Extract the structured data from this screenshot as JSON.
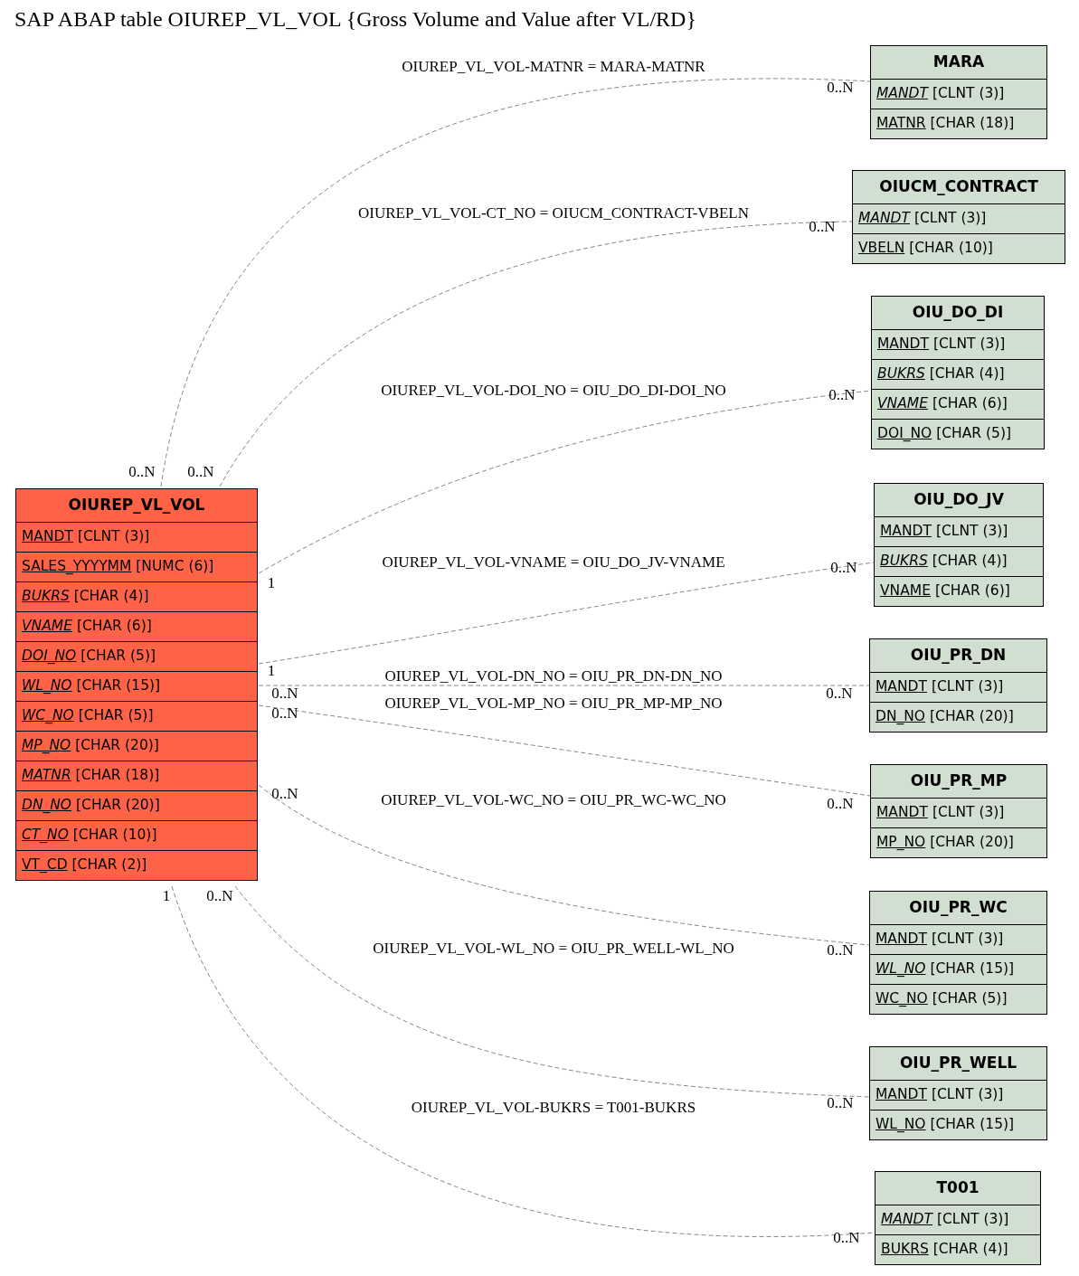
{
  "title": "SAP ABAP table OIUREP_VL_VOL {Gross Volume and Value after VL/RD}",
  "main_table": {
    "name": "OIUREP_VL_VOL",
    "fields": [
      {
        "name": "MANDT",
        "type": "[CLNT (3)]",
        "italic": false
      },
      {
        "name": "SALES_YYYYMM",
        "type": "[NUMC (6)]",
        "italic": false
      },
      {
        "name": "BUKRS",
        "type": "[CHAR (4)]",
        "italic": true
      },
      {
        "name": "VNAME",
        "type": "[CHAR (6)]",
        "italic": true
      },
      {
        "name": "DOI_NO",
        "type": "[CHAR (5)]",
        "italic": true
      },
      {
        "name": "WL_NO",
        "type": "[CHAR (15)]",
        "italic": true
      },
      {
        "name": "WC_NO",
        "type": "[CHAR (5)]",
        "italic": true
      },
      {
        "name": "MP_NO",
        "type": "[CHAR (20)]",
        "italic": true
      },
      {
        "name": "MATNR",
        "type": "[CHAR (18)]",
        "italic": true
      },
      {
        "name": "DN_NO",
        "type": "[CHAR (20)]",
        "italic": true
      },
      {
        "name": "CT_NO",
        "type": "[CHAR (10)]",
        "italic": true
      },
      {
        "name": "VT_CD",
        "type": "[CHAR (2)]",
        "italic": false
      }
    ]
  },
  "related_tables": [
    {
      "name": "MARA",
      "fields": [
        {
          "name": "MANDT",
          "type": "[CLNT (3)]",
          "italic": true
        },
        {
          "name": "MATNR",
          "type": "[CHAR (18)]",
          "italic": false
        }
      ]
    },
    {
      "name": "OIUCM_CONTRACT",
      "fields": [
        {
          "name": "MANDT",
          "type": "[CLNT (3)]",
          "italic": true
        },
        {
          "name": "VBELN",
          "type": "[CHAR (10)]",
          "italic": false
        }
      ]
    },
    {
      "name": "OIU_DO_DI",
      "fields": [
        {
          "name": "MANDT",
          "type": "[CLNT (3)]",
          "italic": false
        },
        {
          "name": "BUKRS",
          "type": "[CHAR (4)]",
          "italic": true
        },
        {
          "name": "VNAME",
          "type": "[CHAR (6)]",
          "italic": true
        },
        {
          "name": "DOI_NO",
          "type": "[CHAR (5)]",
          "italic": false
        }
      ]
    },
    {
      "name": "OIU_DO_JV",
      "fields": [
        {
          "name": "MANDT",
          "type": "[CLNT (3)]",
          "italic": false
        },
        {
          "name": "BUKRS",
          "type": "[CHAR (4)]",
          "italic": true
        },
        {
          "name": "VNAME",
          "type": "[CHAR (6)]",
          "italic": false
        }
      ]
    },
    {
      "name": "OIU_PR_DN",
      "fields": [
        {
          "name": "MANDT",
          "type": "[CLNT (3)]",
          "italic": false
        },
        {
          "name": "DN_NO",
          "type": "[CHAR (20)]",
          "italic": false
        }
      ]
    },
    {
      "name": "OIU_PR_MP",
      "fields": [
        {
          "name": "MANDT",
          "type": "[CLNT (3)]",
          "italic": false
        },
        {
          "name": "MP_NO",
          "type": "[CHAR (20)]",
          "italic": false
        }
      ]
    },
    {
      "name": "OIU_PR_WC",
      "fields": [
        {
          "name": "MANDT",
          "type": "[CLNT (3)]",
          "italic": false
        },
        {
          "name": "WL_NO",
          "type": "[CHAR (15)]",
          "italic": true
        },
        {
          "name": "WC_NO",
          "type": "[CHAR (5)]",
          "italic": false
        }
      ]
    },
    {
      "name": "OIU_PR_WELL",
      "fields": [
        {
          "name": "MANDT",
          "type": "[CLNT (3)]",
          "italic": false
        },
        {
          "name": "WL_NO",
          "type": "[CHAR (15)]",
          "italic": false
        }
      ]
    },
    {
      "name": "T001",
      "fields": [
        {
          "name": "MANDT",
          "type": "[CLNT (3)]",
          "italic": true
        },
        {
          "name": "BUKRS",
          "type": "[CHAR (4)]",
          "italic": false
        }
      ]
    }
  ],
  "relations": [
    {
      "label": "OIUREP_VL_VOL-MATNR = MARA-MATNR",
      "source_cardinality": "0..N",
      "target_cardinality": "0..N"
    },
    {
      "label": "OIUREP_VL_VOL-CT_NO = OIUCM_CONTRACT-VBELN",
      "source_cardinality": "0..N",
      "target_cardinality": "0..N"
    },
    {
      "label": "OIUREP_VL_VOL-DOI_NO = OIU_DO_DI-DOI_NO",
      "source_cardinality": "1",
      "target_cardinality": "0..N"
    },
    {
      "label": "OIUREP_VL_VOL-VNAME = OIU_DO_JV-VNAME",
      "source_cardinality": "1",
      "target_cardinality": "0..N"
    },
    {
      "label": "OIUREP_VL_VOL-DN_NO = OIU_PR_DN-DN_NO",
      "source_cardinality": "0..N",
      "target_cardinality": "0..N"
    },
    {
      "label": "OIUREP_VL_VOL-MP_NO = OIU_PR_MP-MP_NO",
      "source_cardinality": "0..N",
      "target_cardinality": "0..N"
    },
    {
      "label": "OIUREP_VL_VOL-WC_NO = OIU_PR_WC-WC_NO",
      "source_cardinality": "0..N",
      "target_cardinality": "0..N"
    },
    {
      "label": "OIUREP_VL_VOL-WL_NO = OIU_PR_WELL-WL_NO",
      "source_cardinality": "0..N",
      "target_cardinality": "0..N"
    },
    {
      "label": "OIUREP_VL_VOL-BUKRS = T001-BUKRS",
      "source_cardinality": "1",
      "target_cardinality": "0..N"
    }
  ]
}
